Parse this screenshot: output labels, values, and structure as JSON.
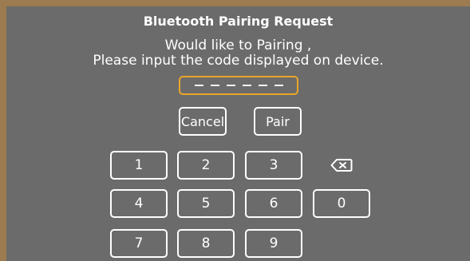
{
  "dialog": {
    "title": "Bluetooth Pairing Request",
    "message_line1": "Would like to Pairing ,",
    "message_line2": "Please input the code displayed on device."
  },
  "code_input": {
    "value": "",
    "placeholder_digits": 6,
    "border_color": "#e9a62a"
  },
  "actions": {
    "cancel_label": "Cancel",
    "pair_label": "Pair"
  },
  "keypad": {
    "keys": [
      "1",
      "2",
      "3",
      "4",
      "5",
      "6",
      "0",
      "7",
      "8",
      "9"
    ],
    "backspace_icon": "backspace-icon"
  },
  "colors": {
    "background": "#6b6b6b",
    "frame": "#9b7b4f",
    "text": "#ffffff"
  }
}
